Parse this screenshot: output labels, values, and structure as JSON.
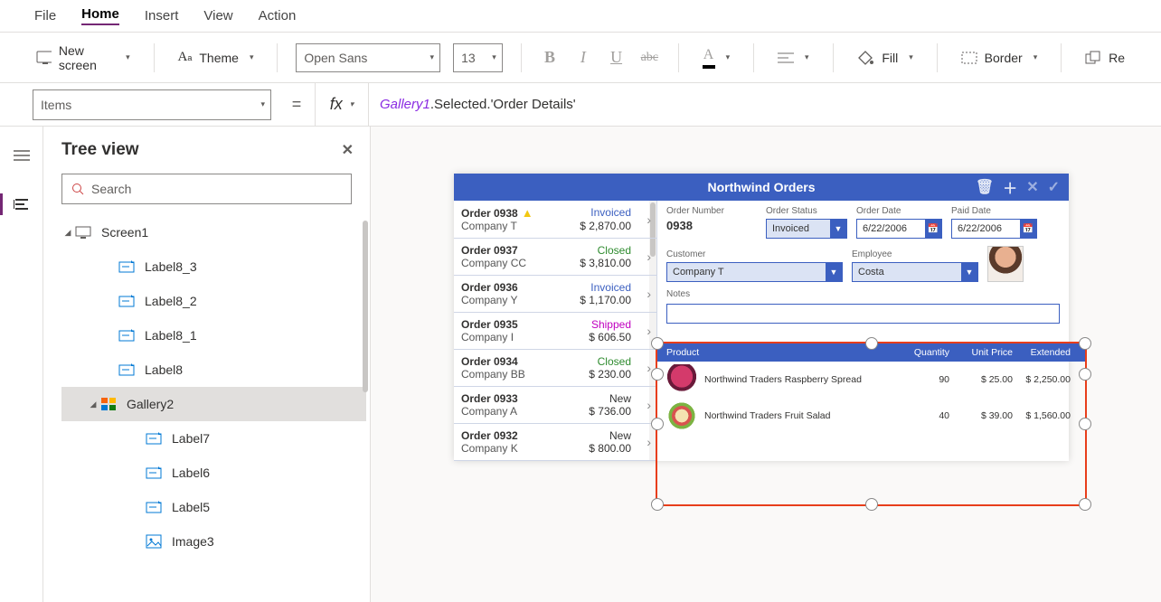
{
  "menu": {
    "file": "File",
    "home": "Home",
    "insert": "Insert",
    "view": "View",
    "action": "Action"
  },
  "ribbon": {
    "newscreen": "New screen",
    "theme": "Theme",
    "font": "Open Sans",
    "size": "13",
    "fill": "Fill",
    "border": "Border",
    "reorder": "Re"
  },
  "formula": {
    "property": "Items",
    "fx": "fx",
    "expr_obj": "Gallery1",
    "expr_rest": ".Selected.'Order Details'"
  },
  "tree": {
    "title": "Tree view",
    "search_ph": "Search",
    "items": [
      {
        "lvl": 1,
        "name": "Screen1",
        "icon": "screen",
        "caret": true
      },
      {
        "lvl": 2,
        "name": "Label8_3",
        "icon": "label"
      },
      {
        "lvl": 2,
        "name": "Label8_2",
        "icon": "label"
      },
      {
        "lvl": 2,
        "name": "Label8_1",
        "icon": "label"
      },
      {
        "lvl": 2,
        "name": "Label8",
        "icon": "label"
      },
      {
        "lvl": 2,
        "name": "Gallery2",
        "icon": "gallery",
        "caret": true,
        "sel": true
      },
      {
        "lvl": 3,
        "name": "Label7",
        "icon": "label"
      },
      {
        "lvl": 3,
        "name": "Label6",
        "icon": "label"
      },
      {
        "lvl": 3,
        "name": "Label5",
        "icon": "label"
      },
      {
        "lvl": 3,
        "name": "Image3",
        "icon": "image"
      }
    ]
  },
  "app": {
    "title": "Northwind Orders",
    "orders": [
      {
        "title": "Order 0938",
        "company": "Company T",
        "status": "Invoiced",
        "statcls": "st-inv",
        "amount": "$ 2,870.00",
        "warn": true
      },
      {
        "title": "Order 0937",
        "company": "Company CC",
        "status": "Closed",
        "statcls": "st-cls",
        "amount": "$ 3,810.00"
      },
      {
        "title": "Order 0936",
        "company": "Company Y",
        "status": "Invoiced",
        "statcls": "st-inv",
        "amount": "$ 1,170.00"
      },
      {
        "title": "Order 0935",
        "company": "Company I",
        "status": "Shipped",
        "statcls": "st-shp",
        "amount": "$ 606.50"
      },
      {
        "title": "Order 0934",
        "company": "Company BB",
        "status": "Closed",
        "statcls": "st-cls",
        "amount": "$ 230.00"
      },
      {
        "title": "Order 0933",
        "company": "Company A",
        "status": "New",
        "statcls": "st-new",
        "amount": "$ 736.00"
      },
      {
        "title": "Order 0932",
        "company": "Company K",
        "status": "New",
        "statcls": "st-new",
        "amount": "$ 800.00"
      }
    ],
    "detail": {
      "labels": {
        "onum": "Order Number",
        "ostat": "Order Status",
        "odate": "Order Date",
        "pdate": "Paid Date",
        "cust": "Customer",
        "emp": "Employee",
        "notes": "Notes"
      },
      "onum": "0938",
      "ostat": "Invoiced",
      "odate": "6/22/2006",
      "pdate": "6/22/2006",
      "cust": "Company T",
      "emp": "Costa"
    },
    "gallery": {
      "headers": {
        "product": "Product",
        "qty": "Quantity",
        "uprice": "Unit Price",
        "ext": "Extended"
      },
      "rows": [
        {
          "name": "Northwind Traders Raspberry Spread",
          "qty": "90",
          "uprice": "$ 25.00",
          "ext": "$ 2,250.00",
          "thumb": "a"
        },
        {
          "name": "Northwind Traders Fruit Salad",
          "qty": "40",
          "uprice": "$ 39.00",
          "ext": "$ 1,560.00",
          "thumb": "b"
        }
      ]
    }
  }
}
